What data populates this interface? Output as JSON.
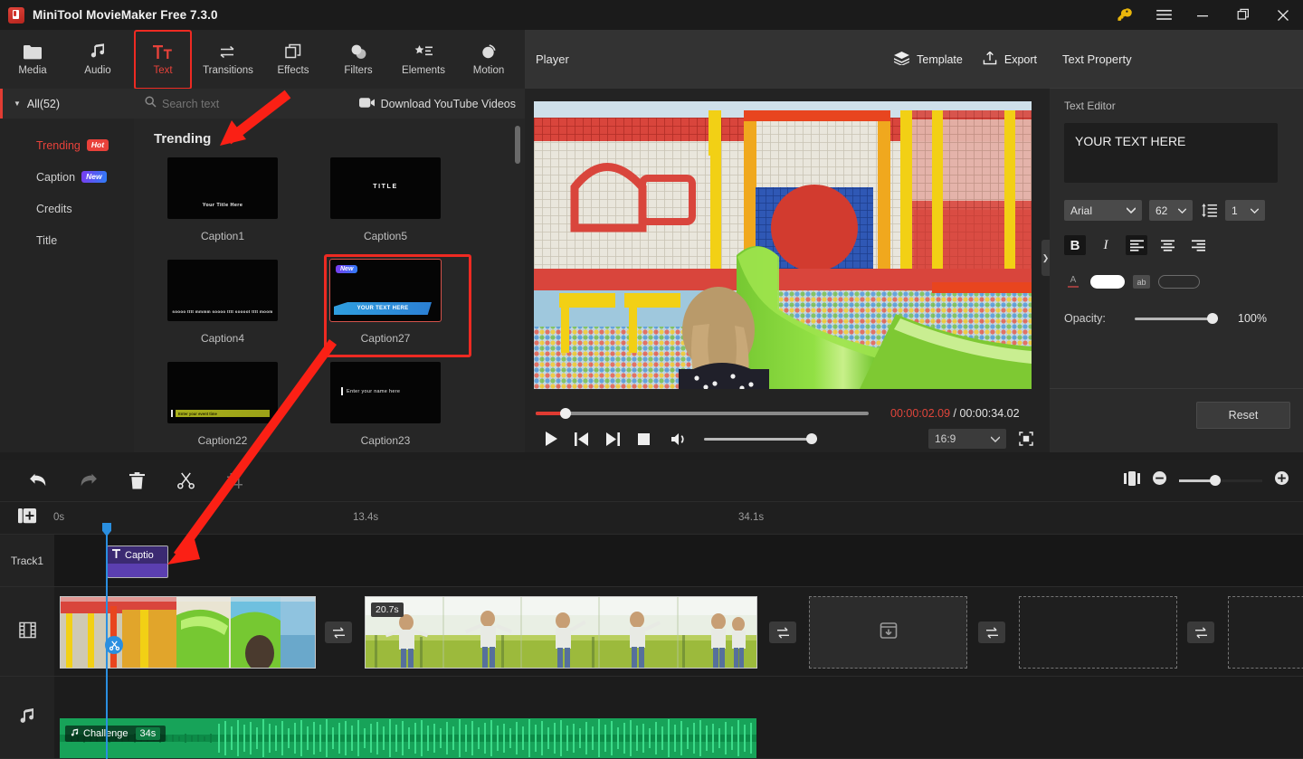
{
  "titlebar": {
    "app_title": "MiniTool MovieMaker Free 7.3.0",
    "key_icon": "key-icon",
    "menu_icon": "hamburger-menu-icon",
    "minimize_icon": "minimize-icon",
    "restore_icon": "restore-icon",
    "close_icon": "close-icon"
  },
  "tooltabs": [
    {
      "label": "Media",
      "icon": "folder-icon",
      "active": false
    },
    {
      "label": "Audio",
      "icon": "music-note-icon",
      "active": false
    },
    {
      "label": "Text",
      "icon": "text-tt-icon",
      "active": true
    },
    {
      "label": "Transitions",
      "icon": "transition-arrows-icon",
      "active": false
    },
    {
      "label": "Effects",
      "icon": "layers-square-icon",
      "active": false
    },
    {
      "label": "Filters",
      "icon": "filters-circles-icon",
      "active": false
    },
    {
      "label": "Elements",
      "icon": "elements-star-list-icon",
      "active": false
    },
    {
      "label": "Motion",
      "icon": "motion-circle-icon",
      "active": false
    }
  ],
  "library": {
    "all_label": "All(52)",
    "caret_icon": "chevron-down-icon",
    "search": {
      "placeholder": "Search text",
      "icon": "search-icon"
    },
    "download_youtube": {
      "label": "Download YouTube Videos",
      "icon": "youtube-download-icon"
    },
    "categories": [
      {
        "label": "Trending",
        "badge": "Hot",
        "badge_type": "hot",
        "active": true
      },
      {
        "label": "Caption",
        "badge": "New",
        "badge_type": "new",
        "active": false
      },
      {
        "label": "Credits",
        "badge": "",
        "badge_type": "",
        "active": false
      },
      {
        "label": "Title",
        "badge": "",
        "badge_type": "",
        "active": false
      }
    ],
    "section_title": "Trending",
    "templates": [
      {
        "name": "Caption1",
        "preview_text": "Your Title Here",
        "style": "your-title",
        "selected": false
      },
      {
        "name": "Caption5",
        "preview_text": "TITLE",
        "style": "title-center",
        "selected": false
      },
      {
        "name": "Caption4",
        "preview_text": "soooo tttt mmmm soooo tttt soooot tttt moom",
        "style": "scroll-text",
        "selected": false
      },
      {
        "name": "Caption27",
        "preview_text": "YOUR TEXT HERE",
        "style": "blue-banner",
        "badge": "New",
        "selected": true
      },
      {
        "name": "Caption22",
        "preview_text": "Enter your event time",
        "style": "lime-bar",
        "selected": false
      },
      {
        "name": "Caption23",
        "preview_text": "Enter your name here",
        "style": "enter-name",
        "selected": false
      }
    ]
  },
  "player": {
    "title": "Player",
    "template_button": {
      "label": "Template",
      "icon": "layers-icon"
    },
    "export_button": {
      "label": "Export",
      "icon": "export-upload-icon"
    },
    "current_time": "00:00:02.09",
    "separator": "/",
    "total_time": "00:00:34.02",
    "progress_percent": 7,
    "controls": [
      {
        "name": "play-button",
        "icon": "play-icon"
      },
      {
        "name": "previous-frame-button",
        "icon": "skip-previous-icon"
      },
      {
        "name": "next-frame-button",
        "icon": "skip-next-icon"
      },
      {
        "name": "stop-button",
        "icon": "stop-icon"
      },
      {
        "name": "volume-button",
        "icon": "volume-icon"
      }
    ],
    "volume_percent": 100,
    "aspect_ratio": "16:9",
    "aspect_caret": "chevron-down-icon",
    "fullscreen_icon": "fit-screen-icon"
  },
  "text_property": {
    "panel_title": "Text Property",
    "section_label": "Text Editor",
    "text_value": "YOUR TEXT HERE",
    "font_family": "Arial",
    "font_size": "62",
    "line_spacing_icon": "line-spacing-icon",
    "line_spacing_value": "1",
    "bold_label": "B",
    "italic_label": "I",
    "align_left_icon": "align-left-icon",
    "align_center_icon": "align-center-icon",
    "align_right_icon": "align-right-icon",
    "text_color_icon": "text-color-a-icon",
    "text_color": "#ffffff",
    "highlight_icon": "ab-highlight-icon",
    "highlight_color": "transparent",
    "opacity_label": "Opacity:",
    "opacity_value": "100%",
    "opacity_percent": 100,
    "reset_button": "Reset"
  },
  "timeline": {
    "toolbar": [
      {
        "name": "undo-button",
        "icon": "undo-arrow-icon",
        "enabled": true
      },
      {
        "name": "redo-button",
        "icon": "redo-arrow-icon",
        "enabled": false
      },
      {
        "name": "delete-button",
        "icon": "trash-icon",
        "enabled": true
      },
      {
        "name": "split-button",
        "icon": "scissors-icon",
        "enabled": true
      },
      {
        "name": "crop-button",
        "icon": "crop-icon",
        "enabled": false
      }
    ],
    "zoom": {
      "fit_icon": "fit-timeline-icon",
      "minus_icon": "zoom-out-icon",
      "plus_icon": "zoom-in-icon",
      "level_percent": 40
    },
    "add_track_icon": "add-track-icon",
    "ruler_labels": [
      "0s",
      "13.4s",
      "34.1s"
    ],
    "playhead_time": "00:00:02.09",
    "tracks": [
      {
        "name": "Track1",
        "type": "text",
        "icon": ""
      },
      {
        "name": "video-track",
        "type": "video",
        "icon": "film-strip-icon"
      },
      {
        "name": "audio-track",
        "type": "audio",
        "icon": "music-note-icon"
      }
    ],
    "text_clip": {
      "label": "Captio",
      "icon": "text-t-icon"
    },
    "video_clips": [
      {
        "duration": "",
        "scene": "playground"
      },
      {
        "duration": "20.7s",
        "scene": "field"
      }
    ],
    "placeholders": [
      {
        "has_icon": true,
        "icon": "import-media-icon"
      },
      {
        "has_icon": false,
        "icon": ""
      },
      {
        "has_icon": false,
        "icon": ""
      }
    ],
    "transition_icon": "transition-arrows-icon",
    "audio_clip": {
      "label": "Challenge",
      "duration": "34s",
      "icon": "music-note-icon"
    },
    "split_marker_icon": "scissors-icon"
  },
  "colors": {
    "accent_red": "#e8423a",
    "playhead_blue": "#2a8fe0",
    "audio_green": "#17a359",
    "text_clip_purple": "#5b3fb0",
    "annotation_red": "#fb2015"
  }
}
